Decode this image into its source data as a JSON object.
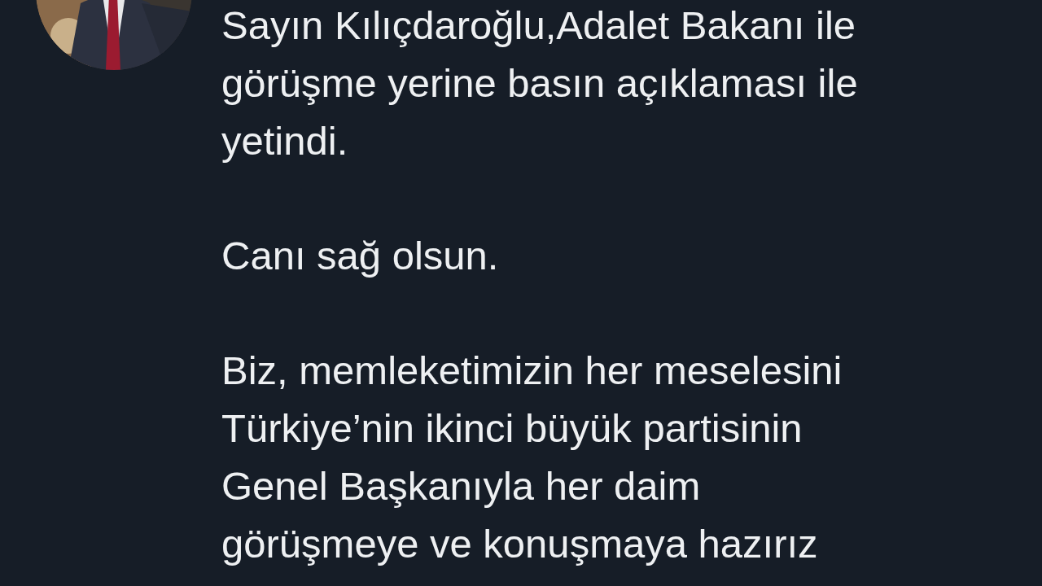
{
  "tweet": {
    "paragraphs": [
      {
        "lines": [
          "Sayın Kılıçdaroğlu,Adalet Bakanı ile",
          "görüşme yerine basın açıklaması ile",
          "yetindi."
        ]
      },
      {
        "lines": [
          "Canı sağ olsun."
        ]
      },
      {
        "lines": [
          "Biz, memleketimizin her meselesini",
          "Türkiye’nin ikinci büyük partisinin",
          "Genel Başkanıyla her daim",
          "görüşmeye ve konuşmaya hazırız"
        ]
      }
    ]
  }
}
